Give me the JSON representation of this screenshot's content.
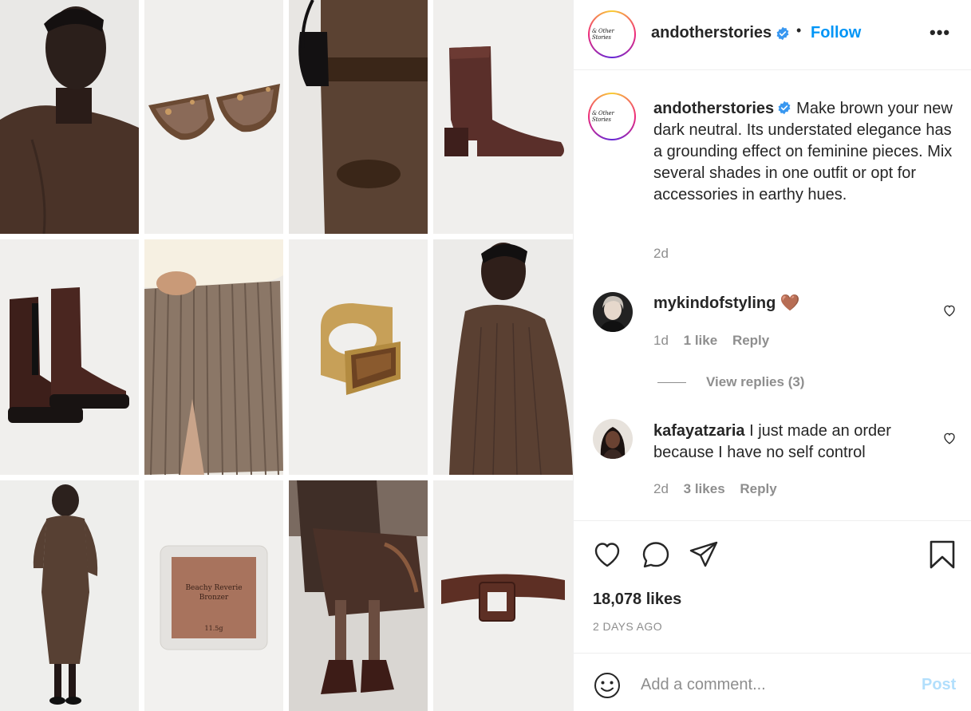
{
  "post": {
    "account": "andotherstories",
    "avatar_logo_text": "& Other Stories",
    "follow_label": "Follow",
    "separator": "•",
    "more_label": "•••",
    "caption_text": "Make brown your new dark neutral. Its understated elegance has a grounding effect on feminine pieces. Mix several shades in one outfit or opt for accessories in earthy hues.",
    "caption_time": "2d",
    "likes": "18,078 likes",
    "date": "2 DAYS AGO"
  },
  "media": {
    "tiles": [
      {
        "subject": "model in brown mock-neck sweatshirt"
      },
      {
        "subject": "tortoiseshell cat-eye sunglasses"
      },
      {
        "subject": "brown crop top and knit skirt with black bag"
      },
      {
        "subject": "brown leather ankle boot"
      },
      {
        "subject": "brown chelsea boots"
      },
      {
        "subject": "pleated taupe skirt"
      },
      {
        "subject": "gold signet ring with tiger eye stone"
      },
      {
        "subject": "model in pleated brown dress"
      },
      {
        "subject": "model in brown knit midi dress"
      },
      {
        "subject": "bronzer compact"
      },
      {
        "subject": "seated model in brown knit skirt and chelsea boots"
      },
      {
        "subject": "brown croc-effect belt"
      }
    ],
    "bronzer_label": "Beachy Reverie Bronzer",
    "bronzer_weight": "11.5g"
  },
  "comments": [
    {
      "username": "mykindofstyling",
      "text": "🤎",
      "time": "1d",
      "likes": "1 like",
      "reply_label": "Reply",
      "view_replies": "View replies (3)"
    },
    {
      "username": "kafayatzaria",
      "text": "I just made an order because I have no self control",
      "time": "2d",
      "likes": "3 likes",
      "reply_label": "Reply"
    }
  ],
  "add_comment": {
    "placeholder": "Add a comment...",
    "post_label": "Post"
  },
  "colors": {
    "link": "#0095f6",
    "muted": "#8e8e8e",
    "post_disabled": "#b2dffc"
  }
}
